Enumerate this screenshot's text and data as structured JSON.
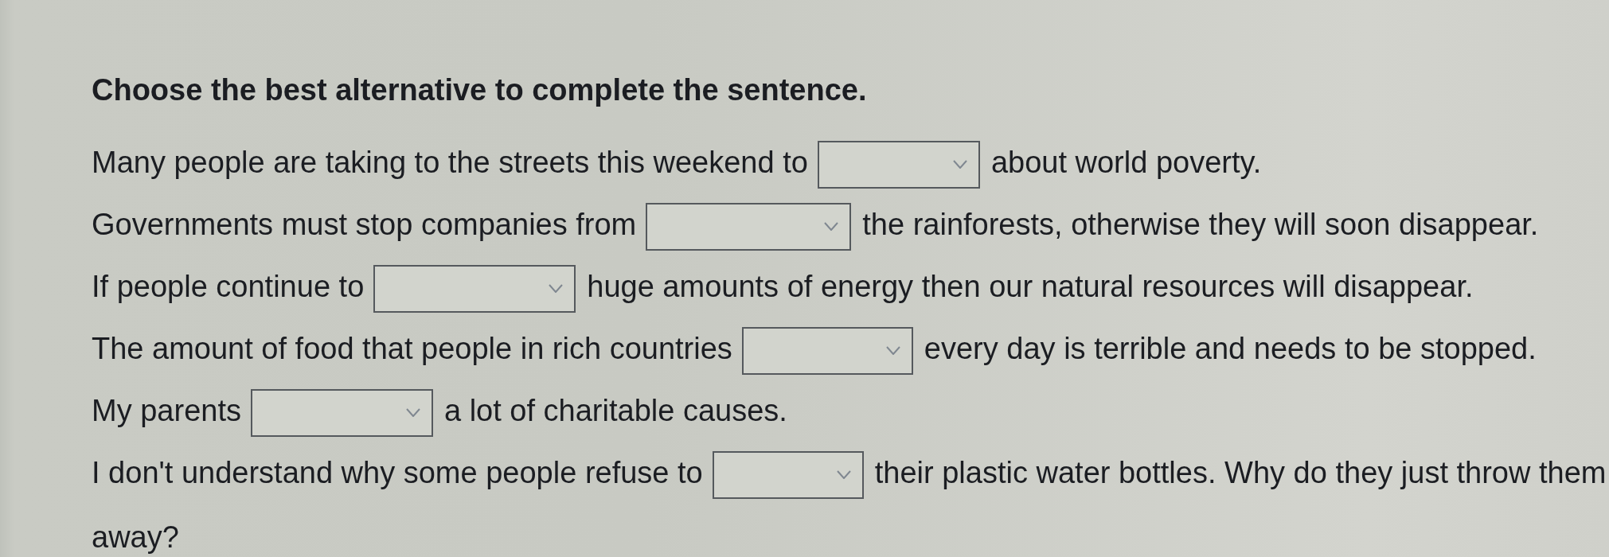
{
  "instruction": "Choose the best alternative to complete the sentence.",
  "questions": [
    {
      "before": "Many people are taking to the streets this weekend to",
      "after": "about world poverty."
    },
    {
      "before": "Governments must stop companies from",
      "after": "the rainforests, otherwise they will soon disappear."
    },
    {
      "before": "If people continue to",
      "after": "huge amounts of energy then our natural resources will disappear."
    },
    {
      "before": "The amount of food that people in rich countries",
      "after": "every day is terrible and needs to be stopped."
    },
    {
      "before": "My parents",
      "after": "a lot of charitable causes."
    },
    {
      "before": "I don't understand why some people refuse to",
      "after": "their plastic water bottles. Why do they just throw them",
      "continued": "away?"
    }
  ]
}
